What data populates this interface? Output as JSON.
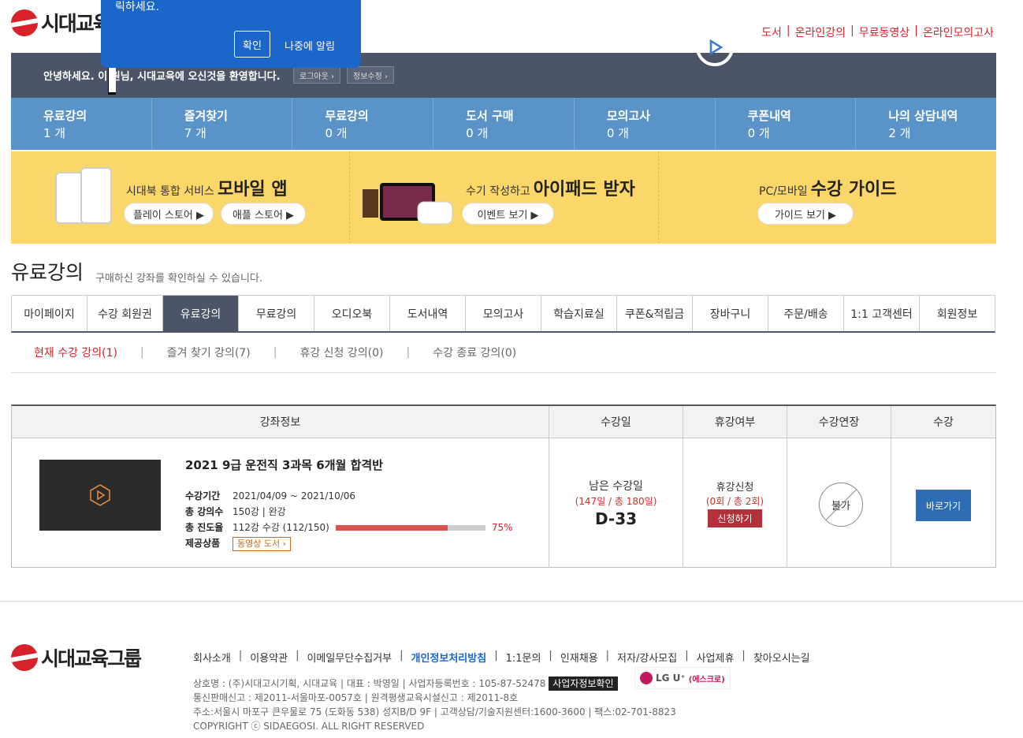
{
  "header": {
    "logo_text": "시대교육",
    "topnav": [
      "도서",
      "온라인강의",
      "무료동영상",
      "온라인모의고사"
    ]
  },
  "popup": {
    "text": "릭하세요.",
    "ok": "확인",
    "later": "나중에 알림"
  },
  "userbar": {
    "message": "안녕하세요. 이  원님, 시대교육에 오신것을 환영합니다.",
    "logout": "로그아웃 ›",
    "edit": "정보수정 ›"
  },
  "stats": [
    {
      "label": "유료강의",
      "value": "1 개"
    },
    {
      "label": "즐겨찾기",
      "value": "7 개"
    },
    {
      "label": "무료강의",
      "value": "0 개"
    },
    {
      "label": "도서 구매",
      "value": "0 개"
    },
    {
      "label": "모의고사",
      "value": "0 개"
    },
    {
      "label": "쿠폰내역",
      "value": "0 개"
    },
    {
      "label": "나의 상담내역",
      "value": "2 개"
    }
  ],
  "promo": {
    "app_pre": "시대북 통합 서비스",
    "app_title": "모바일 앱",
    "play_store": "플레이 스토어 ▶",
    "apple_store": "애플 스토어 ▶",
    "ipad_pre": "수기 작성하고",
    "ipad_title": "아이패드 받자",
    "event_btn": "이벤트 보기 ▶",
    "guide_pre": "PC/모바일",
    "guide_title": "수강 가이드",
    "guide_btn": "가이드 보기 ▶"
  },
  "section": {
    "title": "유료강의",
    "desc": "구매하신 강좌를 확인하실 수 있습니다."
  },
  "tabs": [
    "마이페이지",
    "수강 회원권",
    "유료강의",
    "무료강의",
    "오디오북",
    "도서내역",
    "모의고사",
    "학습지료실",
    "쿠폰&적립금",
    "장바구니",
    "주문/배송",
    "1:1 고객센터",
    "회원정보"
  ],
  "subtabs": [
    "현재 수강 강의(1)",
    "즐겨 찾기 강의(7)",
    "휴강 신청 강의(0)",
    "수강 종료 강의(0)"
  ],
  "table": {
    "headers": [
      "강좌정보",
      "수강일",
      "휴강여부",
      "수강연장",
      "수강"
    ],
    "course_title": "2021 9급 운전직 3과목 6개월 합격반",
    "period_label": "수강기간",
    "period": "2021/04/09 ~ 2021/10/06",
    "lectures_label": "총 강의수",
    "lectures": "150강 | 완강",
    "progress_label": "총 진도율",
    "progress_text": "112강 수강 (112/150)",
    "progress_pct": "75%",
    "progress_fraction": 0.75,
    "product_label": "제공상품",
    "product_btn": "동영상 도서 ›",
    "remain_label": "남은 수강일",
    "remain_detail": "(147일 / 총 180일)",
    "dday": "D-33",
    "pause_label": "휴강신청",
    "pause_detail": "(0회 / 총 2회)",
    "pause_btn": "신청하기",
    "extend": "불가",
    "go_btn": "바로가기"
  },
  "footer": {
    "logo_text": "시대교육그룹",
    "links": [
      "회사소개",
      "이용약관",
      "이메일무단수집거부",
      "개인정보처리방침",
      "1:1문의",
      "인재채용",
      "저자/강사모집",
      "사업제휴",
      "찾아오시는길"
    ],
    "line1": "상호명 : (주)시대고시기획, 시대교육 | 대표 : 박영일 | 사업자등록번호 : 105-87-52478",
    "biz_btn": "사업자정보확인",
    "line2": "통신판매신고 : 제2011-서울마포-0057호 | 원격평생교육시설신고 : 제2011-8호",
    "line3": "주소:서울시 마포구 큰우물로 75 (도화동 538) 성지B/D 9F | 고객상담/기술지원센터:1600-3600 | 팩스:02-701-8823",
    "line4": "COPYRIGHT ⓒ SIDAEGOSI. ALL RIGHT RESERVED",
    "lgu": "LG U⁺",
    "lgu_esc": "(에스크로)"
  }
}
